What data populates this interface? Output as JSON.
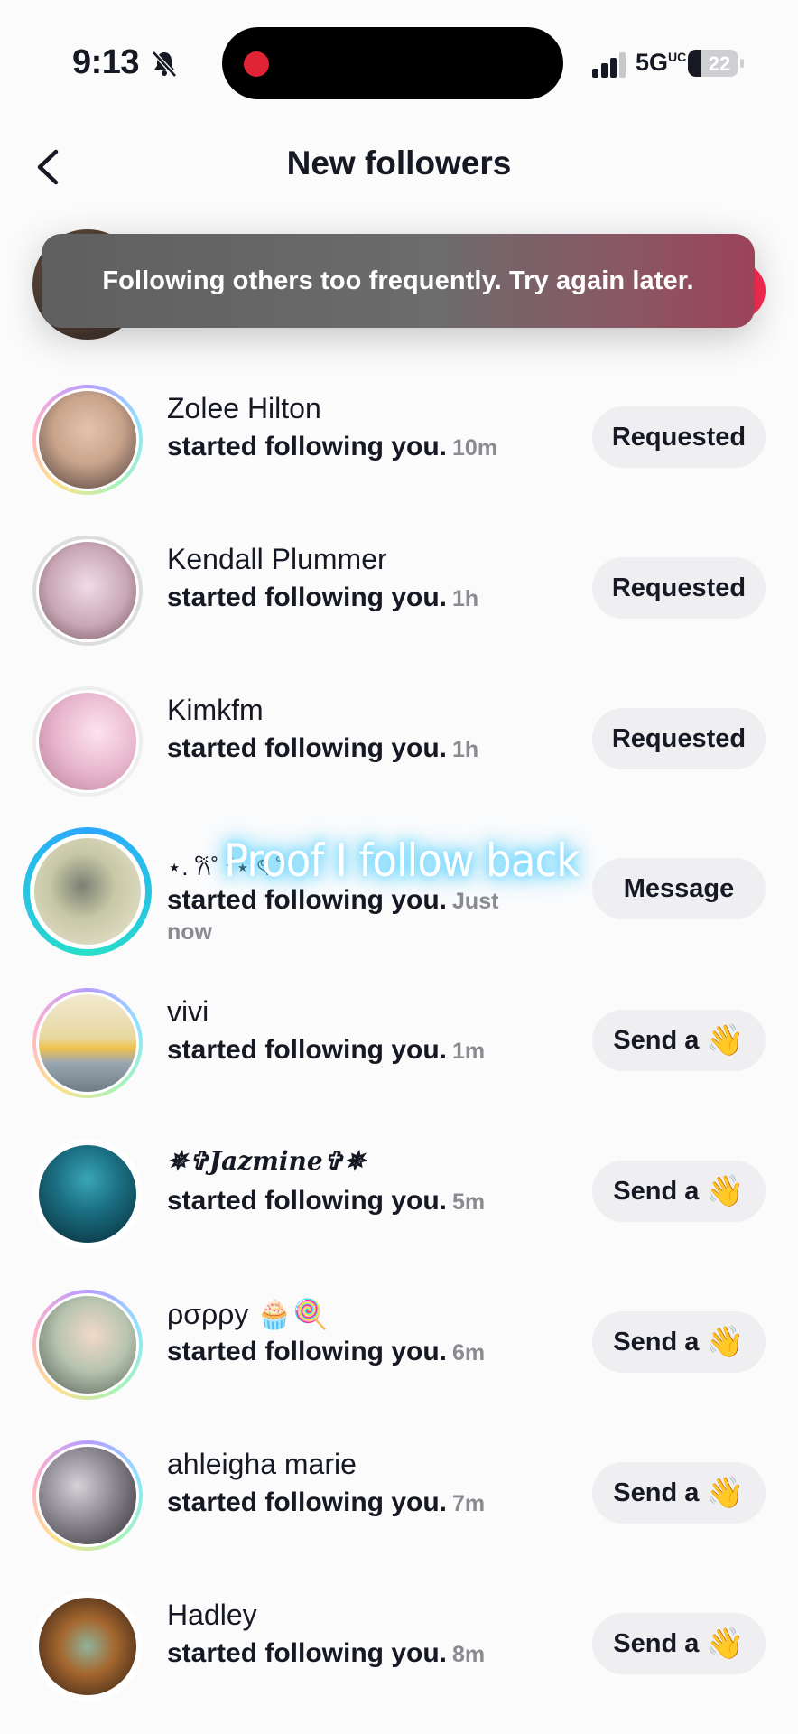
{
  "status": {
    "time": "9:13",
    "network": "5G",
    "network_sup": "UC",
    "battery": "22"
  },
  "header": {
    "title": "New followers"
  },
  "toast": {
    "message": "Following others too frequently. Try again later."
  },
  "hidden_row": {
    "sub": "now"
  },
  "overlay": {
    "caption": "Proof I follow back"
  },
  "followers": [
    {
      "name": "Zolee Hilton",
      "action": "started following you.",
      "time": "10m",
      "button": "Requested",
      "avatar": "#c9a48b"
    },
    {
      "name": "Kendall Plummer",
      "action": "started following you.",
      "time": "1h",
      "button": "Requested",
      "avatar": "#c8a6b5"
    },
    {
      "name": "Kimkfm",
      "action": "started following you.",
      "time": "1h",
      "button": "Requested",
      "avatar": "#e7b6cc"
    },
    {
      "name": "⋆. 𐙚˚ ᐟ⋆ ৎ ˚",
      "action": "started following you.",
      "time": "Just",
      "time2": "now",
      "button": "Message",
      "avatar": "#c7c8a6"
    },
    {
      "name": "vivi",
      "action": "started following you.",
      "time": "1m",
      "button": "Send a",
      "emoji": "👋",
      "avatar": "#e8d8a0"
    },
    {
      "name": "✵✞Jazmine✞✵",
      "action": "started following you.",
      "time": "5m",
      "button": "Send a",
      "emoji": "👋",
      "avatar": "#103a48"
    },
    {
      "name": "ρσρρу 🧁🍭",
      "action": "started following you.",
      "time": "6m",
      "button": "Send a",
      "emoji": "👋",
      "avatar": "#b7c4b0"
    },
    {
      "name": "ahleigha marie",
      "action": "started following you.",
      "time": "7m",
      "button": "Send a",
      "emoji": "👋",
      "avatar": "#8b8790"
    },
    {
      "name": "Hadley",
      "action": "started following you.",
      "time": "8m",
      "button": "Send a",
      "emoji": "👋",
      "avatar": "#5a3a26"
    }
  ]
}
